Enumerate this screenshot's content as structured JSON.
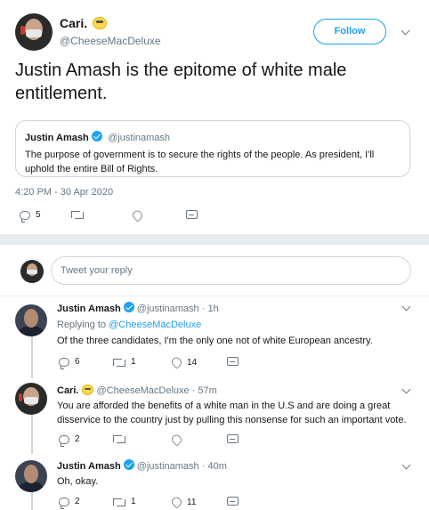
{
  "main_tweet": {
    "author_name": "Cari.",
    "author_handle": "@CheeseMacDeluxe",
    "follow_label": "Follow",
    "text": "Justin Amash is the epitome of white male entitlement.",
    "timestamp": "4:20 PM - 30 Apr 2020",
    "reply_count": "5",
    "quote": {
      "author_name": "Justin Amash",
      "author_handle": "@justinamash",
      "text": "The purpose of government is to secure the rights of the people. As president, I'll uphold the entire Bill of Rights."
    }
  },
  "reply_composer": {
    "placeholder": "Tweet your reply"
  },
  "replies": [
    {
      "author_name": "Justin Amash",
      "author_handle": "@justinamash",
      "time": "· 1h",
      "replying_prefix": "Replying to",
      "replying_to": "@CheeseMacDeluxe",
      "text": "Of the three candidates, I'm the only one not of white European ancestry.",
      "reply_count": "6",
      "retweet_count": "1",
      "like_count": "14"
    },
    {
      "author_name": "Cari.",
      "author_handle": "@CheeseMacDeluxe",
      "time": "· 57m",
      "text": "You are afforded the benefits of a white man in the U.S and are doing a great disservice to the country just by pulling this nonsense for such an important vote.",
      "reply_count": "2"
    },
    {
      "author_name": "Justin Amash",
      "author_handle": "@justinamash",
      "time": "· 40m",
      "text": "Oh, okay.",
      "reply_count": "2",
      "retweet_count": "1",
      "like_count": "11"
    }
  ],
  "icons": {
    "reply": "reply-icon",
    "retweet": "retweet-icon",
    "like": "heart-icon",
    "dm": "envelope-icon",
    "verified": "verified-badge-icon",
    "caret": "chevron-down-icon"
  },
  "colors": {
    "accent": "#1da1f2",
    "muted": "#657786",
    "text": "#14171a",
    "border": "#e6ecf0"
  }
}
